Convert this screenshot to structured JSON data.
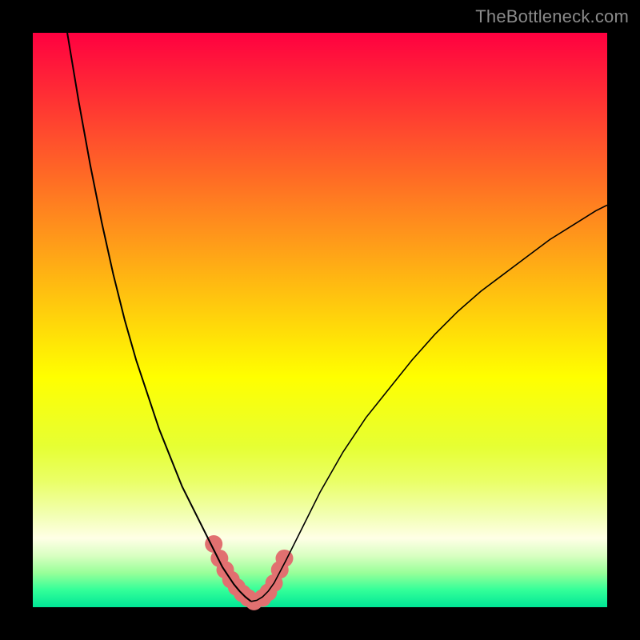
{
  "watermark": "TheBottleneck.com",
  "colors": {
    "page_bg": "#000000",
    "curve_stroke": "#000000",
    "marker_fill": "#e17070",
    "watermark_text": "#8a8a8a",
    "gradient_top": "#ff0040",
    "gradient_bottom": "#00e696"
  },
  "chart_data": {
    "type": "line",
    "title": "",
    "xlabel": "",
    "ylabel": "",
    "xlim": [
      0,
      100
    ],
    "ylim": [
      0,
      100
    ],
    "grid": false,
    "legend": false,
    "annotations": [
      "TheBottleneck.com"
    ],
    "series": [
      {
        "name": "left-branch",
        "x": [
          6,
          8,
          10,
          12,
          14,
          16,
          18,
          20,
          22,
          24,
          26,
          28,
          30,
          32,
          33,
          34,
          35,
          36,
          37,
          38
        ],
        "y": [
          100,
          88,
          77,
          67,
          58,
          50,
          43,
          37,
          31,
          26,
          21,
          17,
          13,
          9,
          7,
          5.5,
          4,
          2.8,
          1.8,
          1.0
        ]
      },
      {
        "name": "right-branch",
        "x": [
          38,
          39,
          40,
          41,
          42,
          44,
          46,
          50,
          54,
          58,
          62,
          66,
          70,
          74,
          78,
          82,
          86,
          90,
          94,
          98,
          100
        ],
        "y": [
          1.0,
          1.2,
          1.8,
          2.8,
          4.2,
          8,
          12,
          20,
          27,
          33,
          38,
          43,
          47.5,
          51.5,
          55,
          58,
          61,
          64,
          66.5,
          69,
          70
        ]
      }
    ],
    "markers": {
      "name": "highlight-cluster",
      "x": [
        31.5,
        32.5,
        33.5,
        34.5,
        35.5,
        36.5,
        37.5,
        38.5,
        40.0,
        41.0,
        42.0,
        43.0,
        43.8
      ],
      "y": [
        11.0,
        8.5,
        6.5,
        4.8,
        3.5,
        2.4,
        1.6,
        1.0,
        1.6,
        2.6,
        4.2,
        6.5,
        8.5
      ]
    }
  }
}
